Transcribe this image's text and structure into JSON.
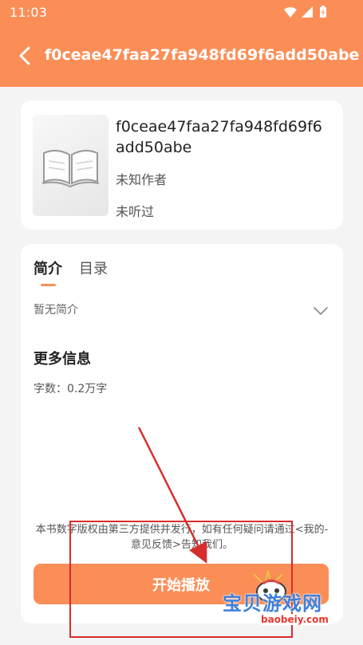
{
  "status_bar": {
    "time": "11:03"
  },
  "header": {
    "title": "f0ceae47faa27fa948fd69f6add50abe"
  },
  "book": {
    "title": "f0ceae47faa27fa948fd69f6add50abe",
    "author": "未知作者",
    "listen_status": "未听过"
  },
  "tabs": [
    {
      "label": "简介",
      "active": true
    },
    {
      "label": "目录",
      "active": false
    }
  ],
  "intro": {
    "text": "暂无简介"
  },
  "more_info": {
    "title": "更多信息",
    "word_count": "字数：0.2万字"
  },
  "disclaimer": "本书数字版权由第三方提供并发行，如有任何疑问请通过<我的-意见反馈>告知我们。",
  "play_button": {
    "label": "开始播放"
  },
  "watermark": {
    "text": "宝贝游戏网",
    "url": "baobeiy.com"
  },
  "colors": {
    "accent": "#fb8e57",
    "annotation": "#d72d2d"
  },
  "icons": [
    "back-arrow-icon",
    "wifi-icon",
    "signal-icon",
    "battery-icon",
    "chevron-down-icon",
    "book-cover-icon"
  ]
}
